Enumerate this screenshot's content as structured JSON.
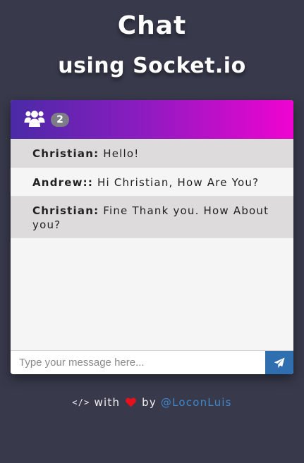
{
  "header": {
    "title": "Chat",
    "subtitle": "using Socket.io"
  },
  "chat": {
    "users_icon": "users-icon",
    "user_count": "2",
    "messages": [
      {
        "author": "Christian:",
        "text": "Hello!"
      },
      {
        "author": "Andrew::",
        "text": "Hi Christian, How Are You?"
      },
      {
        "author": "Christian:",
        "text": "Fine Thank you. How About you?"
      }
    ],
    "input_placeholder": "Type your message here...",
    "send_icon": "paper-plane-icon"
  },
  "footer": {
    "code_icon_text": "</>",
    "with_text": "with",
    "by_text": "by",
    "author_link": "@LoconLuis"
  },
  "colors": {
    "background": "#383a4c",
    "header_gradient_start": "#4a2aa6",
    "header_gradient_end": "#f003d0",
    "send_button": "#2f6fb0",
    "link": "#3f86c8",
    "heart": "#e8101b"
  }
}
